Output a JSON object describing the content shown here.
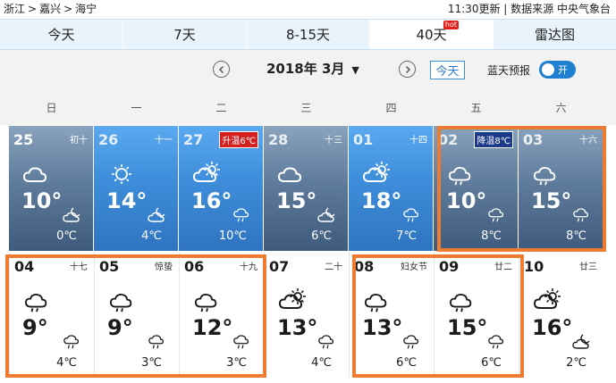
{
  "breadcrumb": {
    "province": "浙江",
    "city": "嘉兴",
    "county": "海宁",
    "sep": ">"
  },
  "meta": {
    "updated": "11:30更新",
    "divider": "|",
    "source": "数据来源 中央气象台"
  },
  "tabs": [
    {
      "label": "今天",
      "active": false
    },
    {
      "label": "7天",
      "active": false
    },
    {
      "label": "8-15天",
      "active": false
    },
    {
      "label": "40天",
      "active": true,
      "badge": "hot"
    },
    {
      "label": "雷达图",
      "active": false
    }
  ],
  "controls": {
    "prev_icon": "chevron-left-icon",
    "month_label": "2018年 3月",
    "caret": "▼",
    "next_icon": "chevron-right-icon",
    "today_label": "今天",
    "bluesky_label": "蓝天预报",
    "toggle_label": "开",
    "toggle_on": true
  },
  "weekdays": [
    "日",
    "一",
    "二",
    "三",
    "四",
    "五",
    "六"
  ],
  "colors": {
    "accent": "#1f7fd1",
    "highlight": "#ee7b30",
    "rise": "#d42020",
    "fall": "#1b3a8a"
  },
  "weeks": [
    [
      {
        "date": "25",
        "lunar": "初十",
        "tag": "",
        "day_icon": "partly-cloudy-icon",
        "high": "10°",
        "night_icon": "cloudy-night-icon",
        "low": "0℃",
        "style": "gray"
      },
      {
        "date": "26",
        "lunar": "十一",
        "tag": "",
        "day_icon": "sunny-icon",
        "high": "14°",
        "night_icon": "cloudy-night-icon",
        "low": "4℃",
        "style": "blue"
      },
      {
        "date": "27",
        "lunar": "",
        "tag": "升温6℃",
        "tag_type": "rise",
        "day_icon": "partly-sunny-icon",
        "high": "16°",
        "night_icon": "rain-night-icon",
        "low": "10℃",
        "style": "blue"
      },
      {
        "date": "28",
        "lunar": "十三",
        "tag": "",
        "day_icon": "cloudy-icon",
        "high": "15°",
        "night_icon": "cloudy-night-icon",
        "low": "6℃",
        "style": "gray"
      },
      {
        "date": "01",
        "lunar": "十四",
        "tag": "",
        "day_icon": "partly-sunny-icon",
        "high": "18°",
        "night_icon": "rain-night-icon",
        "low": "7℃",
        "style": "blue"
      },
      {
        "date": "02",
        "lunar": "",
        "tag": "降温8℃",
        "tag_type": "fall",
        "day_icon": "rain-icon",
        "high": "10°",
        "night_icon": "rain-night-icon",
        "low": "8℃",
        "style": "gray"
      },
      {
        "date": "03",
        "lunar": "十六",
        "tag": "",
        "day_icon": "rain-icon",
        "high": "15°",
        "night_icon": "rain-night-icon",
        "low": "8℃",
        "style": "gray"
      }
    ],
    [
      {
        "date": "04",
        "lunar": "十七",
        "tag": "",
        "day_icon": "rain-icon",
        "high": "9°",
        "night_icon": "rain-night-icon",
        "low": "4℃",
        "style": "white"
      },
      {
        "date": "05",
        "lunar": "惊蛰",
        "tag": "",
        "day_icon": "rain-icon",
        "high": "9°",
        "night_icon": "rain-night-icon",
        "low": "3℃",
        "style": "white"
      },
      {
        "date": "06",
        "lunar": "十九",
        "tag": "",
        "day_icon": "rain-icon",
        "high": "12°",
        "night_icon": "rain-night-icon",
        "low": "3℃",
        "style": "white"
      },
      {
        "date": "07",
        "lunar": "二十",
        "tag": "",
        "day_icon": "partly-sunny-icon",
        "high": "13°",
        "night_icon": "rain-night-icon",
        "low": "4℃",
        "style": "white"
      },
      {
        "date": "08",
        "lunar": "妇女节",
        "tag": "",
        "day_icon": "rain-icon",
        "high": "13°",
        "night_icon": "rain-night-icon",
        "low": "6℃",
        "style": "white"
      },
      {
        "date": "09",
        "lunar": "廿二",
        "tag": "",
        "day_icon": "rain-icon",
        "high": "15°",
        "night_icon": "rain-night-icon",
        "low": "6℃",
        "style": "white"
      },
      {
        "date": "10",
        "lunar": "廿三",
        "tag": "",
        "day_icon": "partly-sunny-icon",
        "high": "16°",
        "night_icon": "cloudy-night-icon",
        "low": "2℃",
        "style": "white"
      }
    ]
  ]
}
